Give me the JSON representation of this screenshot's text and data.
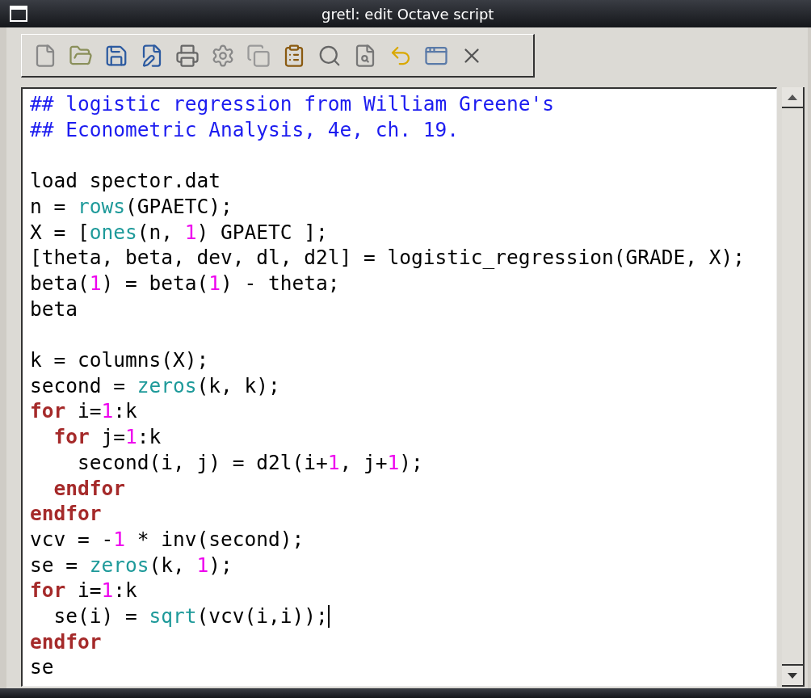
{
  "window": {
    "title": "gretl: edit Octave script"
  },
  "toolbar": {
    "buttons": [
      {
        "kind": "new"
      },
      {
        "kind": "open"
      },
      {
        "kind": "save"
      },
      {
        "kind": "saveas"
      },
      {
        "kind": "print"
      },
      {
        "kind": "run"
      },
      {
        "kind": "copy"
      },
      {
        "kind": "paste"
      },
      {
        "kind": "find"
      },
      {
        "kind": "replace"
      },
      {
        "kind": "undo"
      },
      {
        "kind": "window"
      },
      {
        "kind": "close"
      }
    ]
  },
  "editor": {
    "lines": [
      {
        "kind": "code",
        "segments": [
          {
            "kind": "comment",
            "text": "## logistic regression from William Greene's"
          }
        ]
      },
      {
        "kind": "code",
        "segments": [
          {
            "kind": "comment",
            "text": "## Econometric Analysis, 4e, ch. 19."
          }
        ]
      },
      {
        "kind": "blank"
      },
      {
        "kind": "code",
        "segments": [
          {
            "kind": "plain",
            "text": "load spector.dat"
          }
        ]
      },
      {
        "kind": "code",
        "segments": [
          {
            "kind": "plain",
            "text": "n = "
          },
          {
            "kind": "func",
            "text": "rows"
          },
          {
            "kind": "plain",
            "text": "(GPAETC);"
          }
        ]
      },
      {
        "kind": "code",
        "segments": [
          {
            "kind": "plain",
            "text": "X = ["
          },
          {
            "kind": "func",
            "text": "ones"
          },
          {
            "kind": "plain",
            "text": "(n, "
          },
          {
            "kind": "number",
            "text": "1"
          },
          {
            "kind": "plain",
            "text": ") GPAETC ];"
          }
        ]
      },
      {
        "kind": "code",
        "segments": [
          {
            "kind": "plain",
            "text": "[theta, beta, dev, dl, d2l] = logistic_regression(GRADE, X);"
          }
        ]
      },
      {
        "kind": "code",
        "segments": [
          {
            "kind": "plain",
            "text": "beta("
          },
          {
            "kind": "number",
            "text": "1"
          },
          {
            "kind": "plain",
            "text": ") = beta("
          },
          {
            "kind": "number",
            "text": "1"
          },
          {
            "kind": "plain",
            "text": ") - theta;"
          }
        ]
      },
      {
        "kind": "code",
        "segments": [
          {
            "kind": "plain",
            "text": "beta"
          }
        ]
      },
      {
        "kind": "blank"
      },
      {
        "kind": "code",
        "segments": [
          {
            "kind": "plain",
            "text": "k = columns(X);"
          }
        ]
      },
      {
        "kind": "code",
        "segments": [
          {
            "kind": "plain",
            "text": "second = "
          },
          {
            "kind": "func",
            "text": "zeros"
          },
          {
            "kind": "plain",
            "text": "(k, k);"
          }
        ]
      },
      {
        "kind": "code",
        "segments": [
          {
            "kind": "keyword",
            "text": "for"
          },
          {
            "kind": "plain",
            "text": " i="
          },
          {
            "kind": "number",
            "text": "1"
          },
          {
            "kind": "plain",
            "text": ":k"
          }
        ]
      },
      {
        "kind": "code",
        "segments": [
          {
            "kind": "keyword",
            "text": "  for"
          },
          {
            "kind": "plain",
            "text": " j="
          },
          {
            "kind": "number",
            "text": "1"
          },
          {
            "kind": "plain",
            "text": ":k"
          }
        ]
      },
      {
        "kind": "code",
        "segments": [
          {
            "kind": "plain",
            "text": "    second(i, j) = d2l(i+"
          },
          {
            "kind": "number",
            "text": "1"
          },
          {
            "kind": "plain",
            "text": ", j+"
          },
          {
            "kind": "number",
            "text": "1"
          },
          {
            "kind": "plain",
            "text": ");"
          }
        ]
      },
      {
        "kind": "code",
        "segments": [
          {
            "kind": "keyword",
            "text": "  endfor"
          }
        ]
      },
      {
        "kind": "code",
        "segments": [
          {
            "kind": "keyword",
            "text": "endfor"
          }
        ]
      },
      {
        "kind": "code",
        "segments": [
          {
            "kind": "plain",
            "text": "vcv = -"
          },
          {
            "kind": "number",
            "text": "1"
          },
          {
            "kind": "plain",
            "text": " * inv(second);"
          }
        ]
      },
      {
        "kind": "code",
        "segments": [
          {
            "kind": "plain",
            "text": "se = "
          },
          {
            "kind": "func",
            "text": "zeros"
          },
          {
            "kind": "plain",
            "text": "(k, "
          },
          {
            "kind": "number",
            "text": "1"
          },
          {
            "kind": "plain",
            "text": ");"
          }
        ]
      },
      {
        "kind": "code",
        "segments": [
          {
            "kind": "keyword",
            "text": "for"
          },
          {
            "kind": "plain",
            "text": " i="
          },
          {
            "kind": "number",
            "text": "1"
          },
          {
            "kind": "plain",
            "text": ":k"
          }
        ]
      },
      {
        "kind": "code",
        "cursor": true,
        "segments": [
          {
            "kind": "plain",
            "text": "  se(i) = "
          },
          {
            "kind": "func",
            "text": "sqrt"
          },
          {
            "kind": "plain",
            "text": "(vcv(i,i));"
          }
        ]
      },
      {
        "kind": "code",
        "segments": [
          {
            "kind": "keyword",
            "text": "endfor"
          }
        ]
      },
      {
        "kind": "code",
        "segments": [
          {
            "kind": "plain",
            "text": "se"
          }
        ]
      }
    ]
  }
}
